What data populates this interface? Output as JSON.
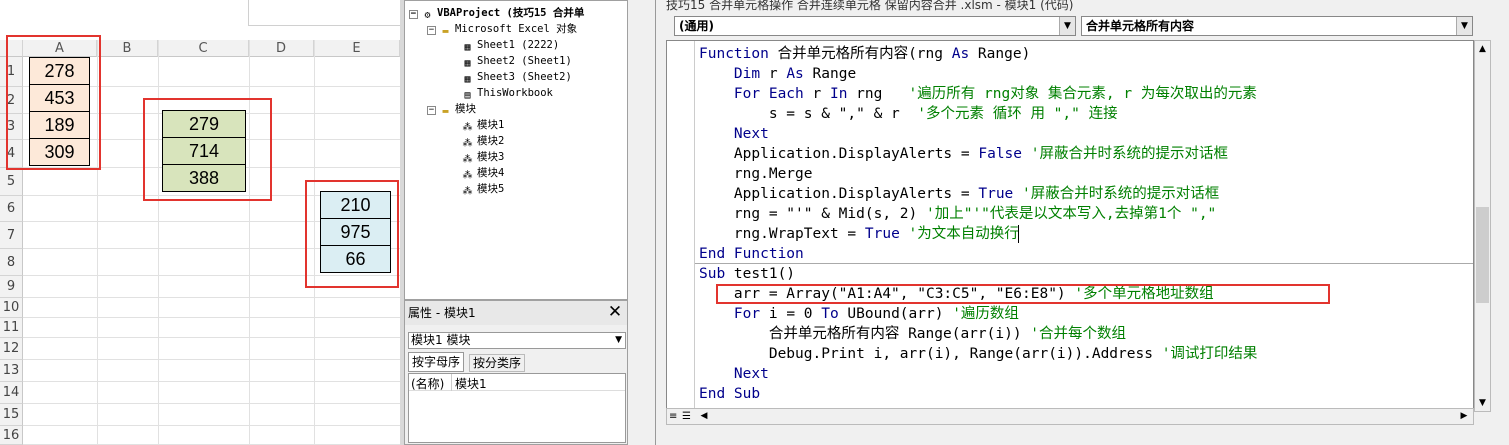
{
  "excel": {
    "columns": [
      "A",
      "B",
      "C",
      "D",
      "E"
    ],
    "rows": [
      "1",
      "2",
      "3",
      "4",
      "5",
      "6",
      "7",
      "8",
      "9",
      "10",
      "11",
      "12",
      "13",
      "14",
      "15",
      "16"
    ],
    "range_a": [
      "278",
      "453",
      "189",
      "309"
    ],
    "range_c": [
      "279",
      "714",
      "388"
    ],
    "range_e": [
      "210",
      "975",
      "66"
    ],
    "colors": {
      "a_fill": "#fde9d9",
      "c_fill": "#d8e4bc",
      "e_fill": "#dbeef3",
      "highlight": "#e2342e"
    }
  },
  "project": {
    "root": "VBAProject (技巧15  合并单",
    "excel_objects": "Microsoft Excel 对象",
    "sheets": [
      "Sheet1 (2222)",
      "Sheet2 (Sheet1)",
      "Sheet3 (Sheet2)",
      "ThisWorkbook"
    ],
    "modules_folder": "模块",
    "modules": [
      "模块1",
      "模块2",
      "模块3",
      "模块4",
      "模块5"
    ]
  },
  "properties": {
    "title": "属性 - 模块1",
    "close": "✕",
    "selected": "模块1 模块",
    "tabs": [
      "按字母序",
      "按分类序"
    ],
    "row_name": "(名称)",
    "row_value": "模块1"
  },
  "code_window": {
    "title": "技巧15  合并单元格操作  合并连续单元格  保留内容合并 .xlsm - 模块1 (代码)",
    "combo_left": "(通用)",
    "combo_right": "合并单元格所有内容"
  },
  "code_lines": [
    {
      "parts": [
        {
          "t": "Function",
          "c": "kw"
        },
        {
          "t": " 合并单元格所有内容(rng ",
          "c": ""
        },
        {
          "t": "As",
          "c": "kw"
        },
        {
          "t": " Range)",
          "c": ""
        }
      ]
    },
    {
      "parts": [
        {
          "t": "    ",
          "c": ""
        },
        {
          "t": "Dim",
          "c": "kw"
        },
        {
          "t": " r ",
          "c": ""
        },
        {
          "t": "As",
          "c": "kw"
        },
        {
          "t": " Range",
          "c": ""
        }
      ]
    },
    {
      "parts": [
        {
          "t": "    ",
          "c": ""
        },
        {
          "t": "For Each",
          "c": "kw"
        },
        {
          "t": " r ",
          "c": ""
        },
        {
          "t": "In",
          "c": "kw"
        },
        {
          "t": " rng   ",
          "c": ""
        },
        {
          "t": "'遍历所有 rng对象 集合元素, r 为每次取出的元素",
          "c": "cm"
        }
      ]
    },
    {
      "parts": [
        {
          "t": "        s = s & \",\" & r  ",
          "c": ""
        },
        {
          "t": "'多个元素 循环 用 \",\" 连接",
          "c": "cm"
        }
      ]
    },
    {
      "parts": [
        {
          "t": "    ",
          "c": ""
        },
        {
          "t": "Next",
          "c": "kw"
        }
      ]
    },
    {
      "parts": [
        {
          "t": "    Application.DisplayAlerts = ",
          "c": ""
        },
        {
          "t": "False",
          "c": "kw"
        },
        {
          "t": " ",
          "c": ""
        },
        {
          "t": "'屏蔽合并时系统的提示对话框",
          "c": "cm"
        }
      ]
    },
    {
      "parts": [
        {
          "t": "    rng.Merge",
          "c": ""
        }
      ]
    },
    {
      "parts": [
        {
          "t": "    Application.DisplayAlerts = ",
          "c": ""
        },
        {
          "t": "True",
          "c": "kw"
        },
        {
          "t": " ",
          "c": ""
        },
        {
          "t": "'屏蔽合并时系统的提示对话框",
          "c": "cm"
        }
      ]
    },
    {
      "parts": [
        {
          "t": "    rng = \"'\" & Mid(s, 2) ",
          "c": ""
        },
        {
          "t": "'加上\"'\"代表是以文本写入,去掉第1个 \",\"",
          "c": "cm"
        }
      ]
    },
    {
      "parts": [
        {
          "t": "    rng.WrapText = ",
          "c": ""
        },
        {
          "t": "True",
          "c": "kw"
        },
        {
          "t": " ",
          "c": ""
        },
        {
          "t": "'为文本自动换行",
          "c": "cm"
        }
      ]
    },
    {
      "parts": [
        {
          "t": "End Function",
          "c": "kw"
        }
      ]
    },
    {
      "parts": [
        {
          "t": "Sub",
          "c": "kw"
        },
        {
          "t": " test1()",
          "c": ""
        }
      ]
    },
    {
      "parts": [
        {
          "t": "    arr = Array(\"A1:A4\", \"C3:C5\", \"E6:E8\") ",
          "c": ""
        },
        {
          "t": "'多个单元格地址数组",
          "c": "cm"
        }
      ]
    },
    {
      "parts": [
        {
          "t": "    ",
          "c": ""
        },
        {
          "t": "For",
          "c": "kw"
        },
        {
          "t": " i = 0 ",
          "c": ""
        },
        {
          "t": "To",
          "c": "kw"
        },
        {
          "t": " UBound(arr) ",
          "c": ""
        },
        {
          "t": "'遍历数组",
          "c": "cm"
        }
      ]
    },
    {
      "parts": [
        {
          "t": "        合并单元格所有内容 Range(arr(i)) ",
          "c": ""
        },
        {
          "t": "'合并每个数组",
          "c": "cm"
        }
      ]
    },
    {
      "parts": [
        {
          "t": "        Debug.Print i, arr(i), Range(arr(i)).Address ",
          "c": ""
        },
        {
          "t": "'调试打印结果",
          "c": "cm"
        }
      ]
    },
    {
      "parts": [
        {
          "t": "    ",
          "c": ""
        },
        {
          "t": "Next",
          "c": "kw"
        }
      ]
    },
    {
      "parts": [
        {
          "t": "End Sub",
          "c": "kw"
        }
      ]
    }
  ]
}
